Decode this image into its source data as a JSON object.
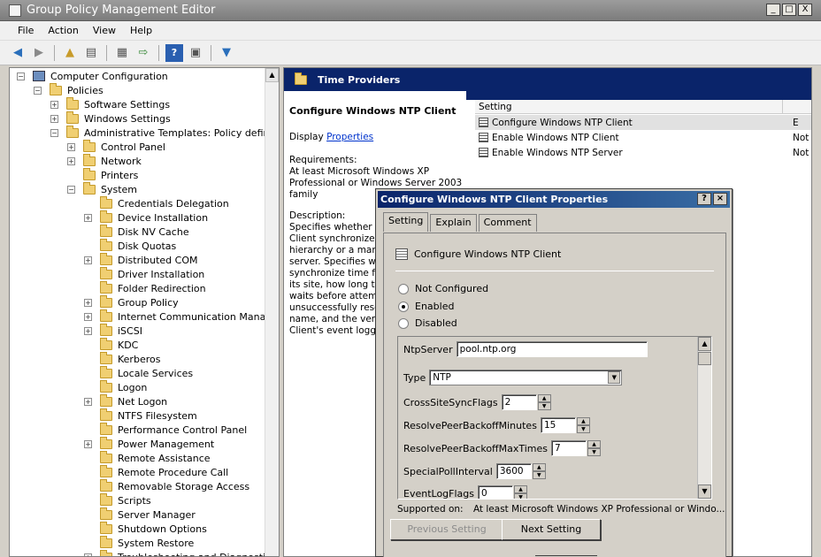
{
  "window": {
    "title": "Group Policy Management Editor",
    "controls": [
      "_",
      "□",
      "X"
    ]
  },
  "menu": [
    "File",
    "Action",
    "View",
    "Help"
  ],
  "toolbar": {
    "icons": [
      "back-icon",
      "forward-icon",
      "up-folder-icon",
      "show-tree-icon",
      "properties-icon",
      "export-icon",
      "help-icon",
      "console-icon",
      "filter-icon"
    ]
  },
  "tree": {
    "root": "Computer Configuration",
    "policies": "Policies",
    "software_settings": "Software Settings",
    "windows_settings": "Windows Settings",
    "admin_templates": "Administrative Templates: Policy definitions",
    "control_panel": "Control Panel",
    "network": "Network",
    "printers": "Printers",
    "system": "System",
    "system_children": [
      {
        "label": "Credentials Delegation",
        "exp": false
      },
      {
        "label": "Device Installation",
        "exp": true
      },
      {
        "label": "Disk NV Cache",
        "exp": false
      },
      {
        "label": "Disk Quotas",
        "exp": false
      },
      {
        "label": "Distributed COM",
        "exp": true
      },
      {
        "label": "Driver Installation",
        "exp": false
      },
      {
        "label": "Folder Redirection",
        "exp": false
      },
      {
        "label": "Group Policy",
        "exp": true
      },
      {
        "label": "Internet Communication Manageme",
        "exp": true
      },
      {
        "label": "iSCSI",
        "exp": true
      },
      {
        "label": "KDC",
        "exp": false
      },
      {
        "label": "Kerberos",
        "exp": false
      },
      {
        "label": "Locale Services",
        "exp": false
      },
      {
        "label": "Logon",
        "exp": false
      },
      {
        "label": "Net Logon",
        "exp": true
      },
      {
        "label": "NTFS Filesystem",
        "exp": false
      },
      {
        "label": "Performance Control Panel",
        "exp": false
      },
      {
        "label": "Power Management",
        "exp": true
      },
      {
        "label": "Remote Assistance",
        "exp": false
      },
      {
        "label": "Remote Procedure Call",
        "exp": false
      },
      {
        "label": "Removable Storage Access",
        "exp": false
      },
      {
        "label": "Scripts",
        "exp": false
      },
      {
        "label": "Server Manager",
        "exp": false
      },
      {
        "label": "Shutdown Options",
        "exp": false
      },
      {
        "label": "System Restore",
        "exp": false
      },
      {
        "label": "Troubleshooting and Diagnostics",
        "exp": true
      }
    ]
  },
  "right": {
    "header": "Time Providers",
    "desc_title": "Configure Windows NTP Client",
    "display_label": "Display",
    "properties_link": "Properties",
    "requirements_lines": [
      "Requirements:",
      "At least Microsoft Windows XP",
      "Professional or Windows Server 2003",
      "family"
    ],
    "description_lines": [
      "Description:",
      "Specifies whether th",
      "Client synchronizes t",
      "hierarchy or a manu",
      "server. Specifies wh",
      "synchronize time fro",
      "its site, how long the",
      "waits before attemp",
      "unsuccessfully resol",
      "name, and the verbo",
      "Client's event loggin"
    ],
    "list_header": {
      "setting": "Setting"
    },
    "rows": [
      {
        "name": "Configure Windows NTP Client",
        "state": "E"
      },
      {
        "name": "Enable Windows NTP Client",
        "state": "Not"
      },
      {
        "name": "Enable Windows NTP Server",
        "state": "Not"
      }
    ]
  },
  "dialog": {
    "title": "Configure Windows NTP Client Properties",
    "tabs": [
      "Setting",
      "Explain",
      "Comment"
    ],
    "setting_name": "Configure Windows NTP Client",
    "radios": [
      {
        "label": "Not Configured",
        "checked": false
      },
      {
        "label": "Enabled",
        "checked": true
      },
      {
        "label": "Disabled",
        "checked": false
      }
    ],
    "options": {
      "ntp_server_label": "NtpServer",
      "ntp_server_value": "pool.ntp.org",
      "type_label": "Type",
      "type_value": "NTP",
      "cross_label": "CrossSiteSyncFlags",
      "cross_value": "2",
      "backoff_min_label": "ResolvePeerBackoffMinutes",
      "backoff_min_value": "15",
      "backoff_max_label": "ResolvePeerBackoffMaxTimes",
      "backoff_max_value": "7",
      "poll_label": "SpecialPollInterval",
      "poll_value": "3600",
      "event_label": "EventLogFlags",
      "event_value": "0"
    },
    "supported_label": "Supported on:",
    "supported_value": "At least Microsoft Windows XP Professional or Windo...",
    "prev_button": "Previous Setting",
    "next_button": "Next Setting"
  }
}
